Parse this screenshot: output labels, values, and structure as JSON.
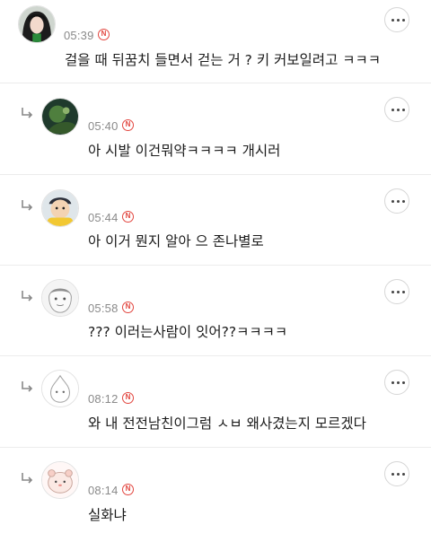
{
  "comments": [
    {
      "time": "05:39",
      "badge": "N",
      "text": "걸을 때 뒤꿈치 들면서 걷는 거 ? 키 커보일려고 ㅋㅋㅋ",
      "is_reply": false
    },
    {
      "time": "05:40",
      "badge": "N",
      "text": "아 시발 이건뭐약ㅋㅋㅋㅋ 개시러",
      "is_reply": true
    },
    {
      "time": "05:44",
      "badge": "N",
      "text": "아 이거 뭔지 알아 으 존나별로",
      "is_reply": true
    },
    {
      "time": "05:58",
      "badge": "N",
      "text": "??? 이러는사람이 잇어??ㅋㅋㅋㅋ",
      "is_reply": true
    },
    {
      "time": "08:12",
      "badge": "N",
      "text": "와 내 전전남친이그럼 ㅅㅂ 왜사겼는지 모르겠다",
      "is_reply": true
    },
    {
      "time": "08:14",
      "badge": "N",
      "text": "실화냐",
      "is_reply": true
    }
  ],
  "colors": {
    "badge": "#e2463f",
    "time": "#8a8a8a",
    "divider": "#ececec",
    "text": "#1b1b1b"
  },
  "icons": {
    "reply": "reply-arrow-icon",
    "more": "more-options-icon",
    "badge": "new-badge-icon"
  }
}
